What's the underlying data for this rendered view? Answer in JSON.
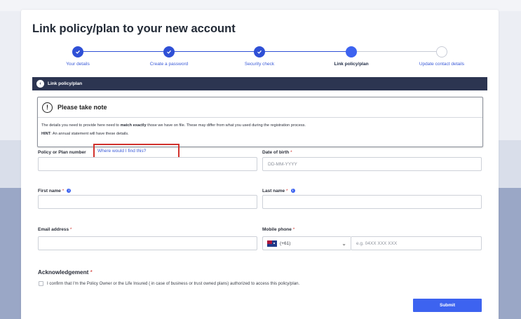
{
  "page": {
    "title": "Link policy/plan to your new account"
  },
  "stepper": {
    "steps": [
      {
        "label": "Your details",
        "state": "done"
      },
      {
        "label": "Create a password",
        "state": "done"
      },
      {
        "label": "Security check",
        "state": "done"
      },
      {
        "label": "Link policy/plan",
        "state": "active"
      },
      {
        "label": "Update contact details",
        "state": "todo"
      }
    ]
  },
  "section": {
    "title": "Link policy/plan"
  },
  "note": {
    "title": "Please take note",
    "line1_pre": "The details you need to provide here need to ",
    "line1_bold": "match exactly",
    "line1_post": " those we have on file. These may differ from what you used during the registration process.",
    "hint_label": "HINT",
    "hint_text": ": An annual statement will have these details."
  },
  "form": {
    "policy_label": "Policy or Plan number",
    "policy_help_link": "Where would I find this?",
    "dob_label": "Date of birth",
    "dob_placeholder": "DD-MM-YYYY",
    "first_name_label": "First name",
    "last_name_label": "Last name",
    "email_label": "Email address",
    "mobile_label": "Mobile phone",
    "country_code": "(+61)",
    "mobile_placeholder": "e.g. 04XX XXX XXX",
    "required_marker": "*",
    "info_glyph": "i"
  },
  "acknowledgement": {
    "title": "Acknowledgement",
    "text": "I confirm that I'm the Policy Owner or the Life Insured ( in case of business or trust owned plans) authorized to access this policy/plan."
  },
  "actions": {
    "submit_label": "Submit"
  },
  "icons": {
    "step_done": "check-icon",
    "back": "back-arrow-icon",
    "note": "exclamation-icon",
    "chevron": "chevron-down-icon",
    "flag": "australia-flag-icon"
  },
  "colors": {
    "primary": "#3d63f0",
    "header_bar": "#2c3551",
    "required": "#d2322d",
    "highlight_border": "#d2322d"
  }
}
